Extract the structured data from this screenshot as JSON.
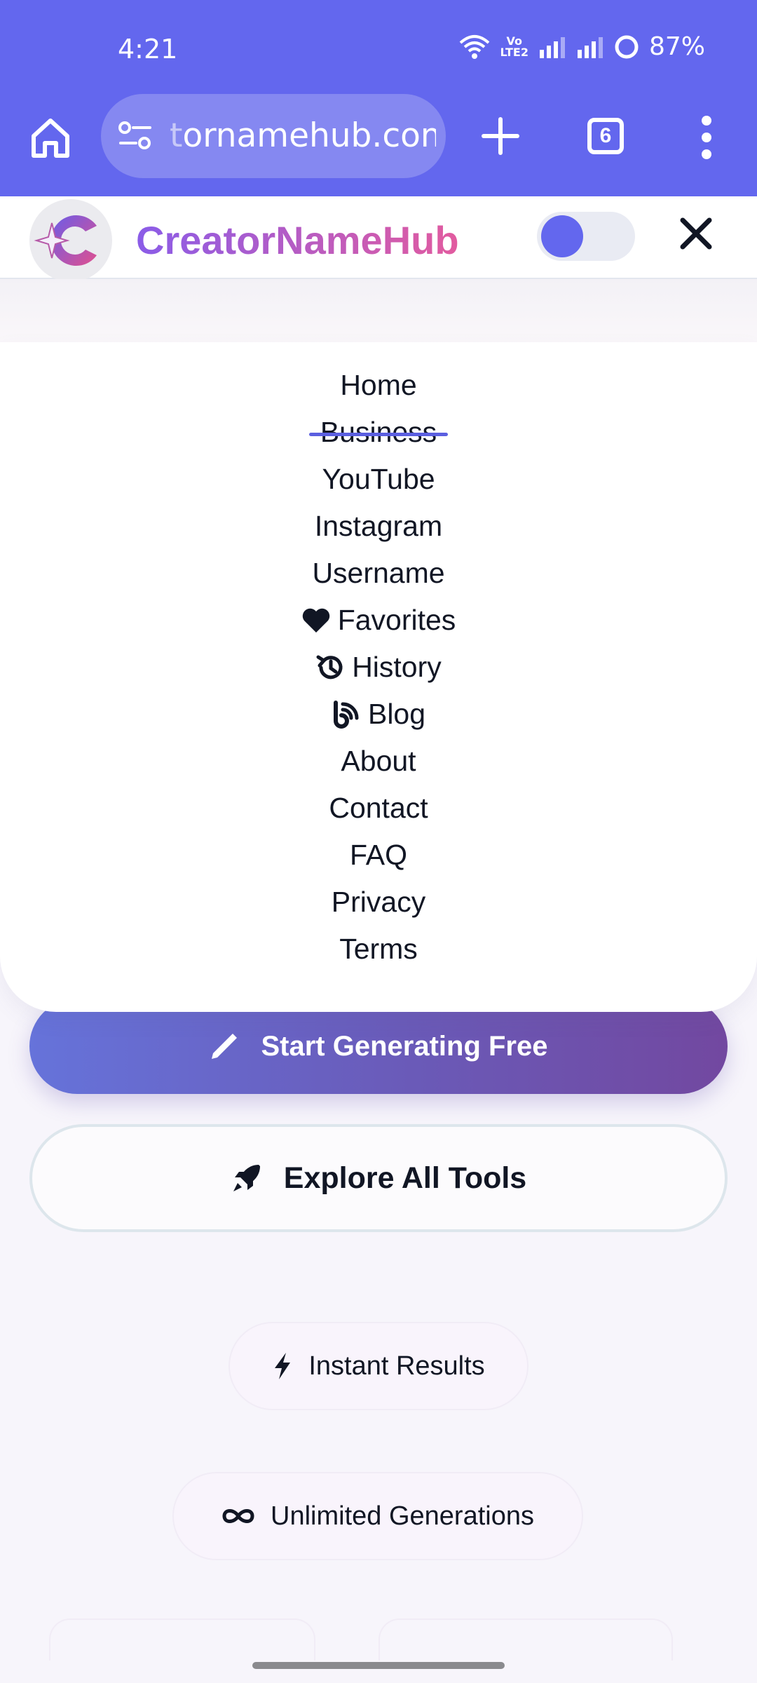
{
  "status_bar": {
    "time": "4:21",
    "battery": "87%",
    "network_label": "VoLTE2"
  },
  "browser": {
    "url_faded": "t",
    "url": "ornamehub.com",
    "tab_count": "6"
  },
  "site": {
    "brand": "CreatorNameHub"
  },
  "nav": {
    "items": [
      {
        "label": "Home",
        "icon": null
      },
      {
        "label": "Business",
        "icon": null
      },
      {
        "label": "YouTube",
        "icon": null
      },
      {
        "label": "Instagram",
        "icon": null
      },
      {
        "label": "Username",
        "icon": null
      },
      {
        "label": "Favorites",
        "icon": "heart-icon"
      },
      {
        "label": "History",
        "icon": "history-icon"
      },
      {
        "label": "Blog",
        "icon": "blog-icon"
      },
      {
        "label": "About",
        "icon": null
      },
      {
        "label": "Contact",
        "icon": null
      },
      {
        "label": "FAQ",
        "icon": null
      },
      {
        "label": "Privacy",
        "icon": null
      },
      {
        "label": "Terms",
        "icon": null
      }
    ]
  },
  "cta": {
    "primary_label": "Start Generating Free",
    "secondary_label": "Explore All Tools"
  },
  "features": {
    "instant": "Instant Results",
    "unlimited": "Unlimited Generations"
  },
  "colors": {
    "brand_bar": "#6367ee",
    "accent": "#5b5fe0",
    "brand_gradient_start": "#8a5ce8",
    "brand_gradient_end": "#e25b9f"
  }
}
